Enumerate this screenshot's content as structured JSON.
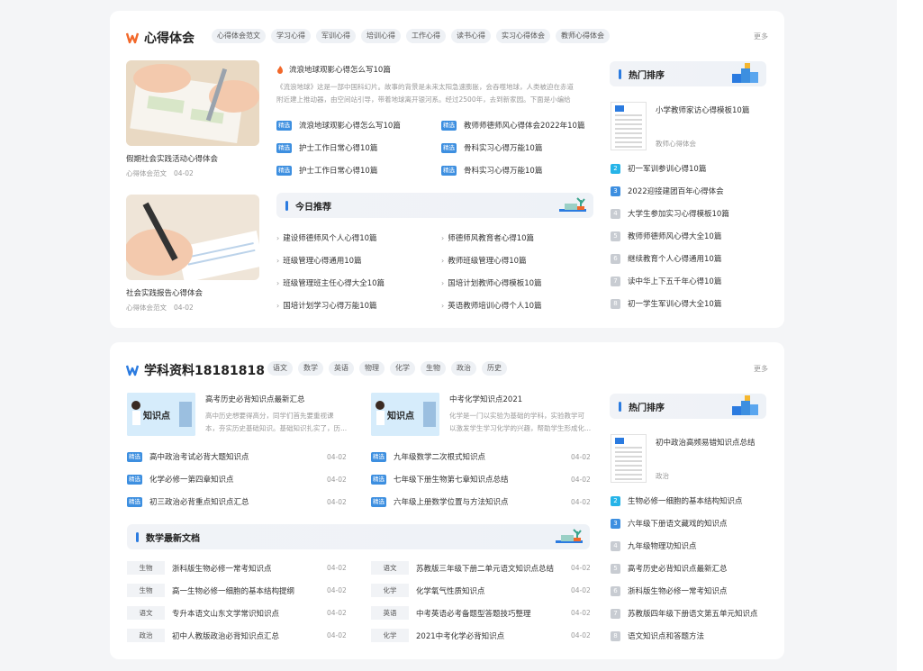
{
  "section1": {
    "title": "心得体会",
    "tags": [
      "心得体会范文",
      "学习心得",
      "军训心得",
      "培训心得",
      "工作心得",
      "读书心得",
      "实习心得体会",
      "教师心得体会"
    ],
    "more": "更多",
    "featured": [
      {
        "caption": "假期社会实践活动心得体会",
        "category": "心得体会范文",
        "date": "04-02"
      },
      {
        "caption": "社会实践报告心得体会",
        "category": "心得体会范文",
        "date": "04-02"
      }
    ],
    "hot_article": {
      "title": "流浪地球观影心得怎么写10篇",
      "excerpt": "《流浪地球》这是一部中国科幻片。故事的背景是未来太阳急速膨胀，会吞噬地球，人类被迫在赤道附近建上推动器，由空间站引导，带着地球离开银河系。经过2500年，去到新家园。下面是小编给大家整理的..."
    },
    "badge_label": "精选",
    "picks_left": [
      "流浪地球观影心得怎么写10篇",
      "护士工作日常心得10篇",
      "护士工作日常心得10篇"
    ],
    "picks_right": [
      "教师师德师风心得体会2022年10篇",
      "骨科实习心得万能10篇",
      "骨科实习心得万能10篇"
    ],
    "today": {
      "title": "今日推荐",
      "left": [
        "建设师德师风个人心得10篇",
        "班级管理心得通用10篇",
        "班级管理班主任心得大全10篇",
        "国培计划学习心得万能10篇"
      ],
      "right": [
        "师德师风教育者心得10篇",
        "教师班级管理心得10篇",
        "国培计划教师心得模板10篇",
        "英语教师培训心得个人10篇"
      ]
    },
    "ranking": {
      "title": "热门排序",
      "top": {
        "title": "小学教师家访心得模板10篇",
        "category": "教师心得体会"
      },
      "items": [
        {
          "num": "2",
          "text": "初一军训参训心得10篇"
        },
        {
          "num": "3",
          "text": "2022迎接建团百年心得体会"
        },
        {
          "num": "4",
          "text": "大学生参加实习心得模板10篇"
        },
        {
          "num": "5",
          "text": "教师师德师风心得大全10篇"
        },
        {
          "num": "6",
          "text": "继续教育个人心得通用10篇"
        },
        {
          "num": "7",
          "text": "读中华上下五千年心得10篇"
        },
        {
          "num": "8",
          "text": "初一学生军训心得大全10篇"
        }
      ]
    }
  },
  "section2": {
    "title": "学科资料18181818",
    "tags": [
      "语文",
      "数学",
      "英语",
      "物理",
      "化学",
      "生物",
      "政治",
      "历史"
    ],
    "more": "更多",
    "features": [
      {
        "thumb_text": "知识点",
        "title": "高考历史必背知识点最新汇总",
        "desc1": "高中历史想要得高分，同学们首先要重视课",
        "desc2": "本，夯实历史基础知识。基础知识扎实了，历..."
      },
      {
        "thumb_text": "知识点",
        "title": "中考化学知识点2021",
        "desc1": "化学是一门以实验为基础的学科，实验教学可",
        "desc2": "以激发学生学习化学的兴趣，帮助学生形成化..."
      }
    ],
    "badge_label": "精选",
    "list_left": [
      {
        "text": "高中政治考试必背大题知识点",
        "date": "04-02"
      },
      {
        "text": "化学必修一第四章知识点",
        "date": "04-02"
      },
      {
        "text": "初三政治必背重点知识点汇总",
        "date": "04-02"
      }
    ],
    "list_right": [
      {
        "text": "九年级数学二次根式知识点",
        "date": "04-02"
      },
      {
        "text": "七年级下册生物第七章知识点总结",
        "date": "04-02"
      },
      {
        "text": "六年级上册数学位置与方法知识点",
        "date": "04-02"
      }
    ],
    "latest": {
      "title": "数学最新文档",
      "left": [
        {
          "subject": "生物",
          "text": "浙科版生物必修一常考知识点",
          "date": "04-02"
        },
        {
          "subject": "生物",
          "text": "高一生物必修一细胞的基本结构提纲",
          "date": "04-02"
        },
        {
          "subject": "语文",
          "text": "专升本语文山东文学常识知识点",
          "date": "04-02"
        },
        {
          "subject": "政治",
          "text": "初中人教版政治必背知识点汇总",
          "date": "04-02"
        }
      ],
      "right": [
        {
          "subject": "语文",
          "text": "苏教版三年级下册二单元语文知识点总结",
          "date": "04-02"
        },
        {
          "subject": "化学",
          "text": "化学氧气性质知识点",
          "date": "04-02"
        },
        {
          "subject": "英语",
          "text": "中考英语必考备题型答题技巧整理",
          "date": "04-02"
        },
        {
          "subject": "化学",
          "text": "2021中考化学必背知识点",
          "date": "04-02"
        }
      ]
    },
    "ranking": {
      "title": "热门排序",
      "top": {
        "title": "初中政治高频易错知识点总结",
        "category": "政治"
      },
      "items": [
        {
          "num": "2",
          "text": "生物必修一细胞的基本结构知识点"
        },
        {
          "num": "3",
          "text": "六年级下册语文藏戏的知识点"
        },
        {
          "num": "4",
          "text": "九年级物理功知识点"
        },
        {
          "num": "5",
          "text": "高考历史必背知识点最新汇总"
        },
        {
          "num": "6",
          "text": "浙科版生物必修一常考知识点"
        },
        {
          "num": "7",
          "text": "苏教版四年级下册语文第五单元知识点"
        },
        {
          "num": "8",
          "text": "语文知识点和答题方法"
        }
      ]
    }
  },
  "colors": {
    "accent_blue": "#3d8fe0",
    "logo_orange": "#f2682a",
    "logo_blue": "#2b7be0",
    "rank_cyan": "#26b4e8"
  }
}
